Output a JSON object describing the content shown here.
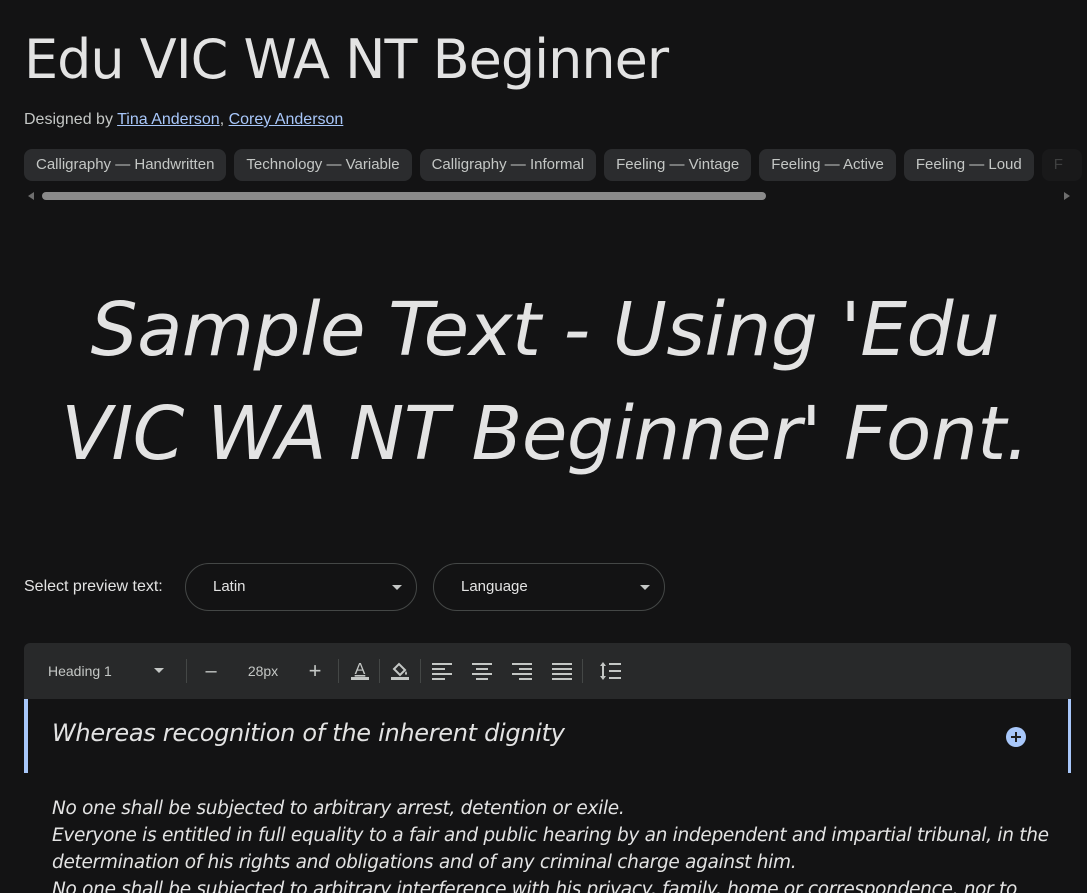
{
  "header": {
    "title": "Edu VIC WA NT Beginner",
    "designed_by_prefix": "Designed by ",
    "designers": [
      "Tina Anderson",
      "Corey Anderson"
    ],
    "designer_separator": ", "
  },
  "tags": [
    "Calligraphy — Handwritten",
    "Technology — Variable",
    "Calligraphy — Informal",
    "Feeling — Vintage",
    "Feeling — Active",
    "Feeling — Loud",
    "F"
  ],
  "sample_text": "Sample Text - Using 'Edu VIC WA NT Beginner' Font.",
  "preview": {
    "label": "Select preview text:",
    "script_select": "Latin",
    "language_select": "Language"
  },
  "toolbar": {
    "style": "Heading 1",
    "decrease": "–",
    "size": "28px",
    "increase": "+",
    "icons": [
      "text-color-icon",
      "fill-color-icon",
      "align-left-icon",
      "align-center-icon",
      "align-right-icon",
      "align-justify-icon",
      "line-spacing-icon"
    ]
  },
  "editor": {
    "heading": "Whereas recognition of the inherent dignity",
    "paragraphs": [
      "No one shall be subjected to arbitrary arrest, detention or exile.",
      "Everyone is entitled in full equality to a fair and public hearing by an independent and impartial tribunal, in the determination of his rights and obligations and of any criminal charge against him.",
      "No one shall be subjected to arbitrary interference with his privacy, family, home or correspondence, nor to"
    ]
  },
  "colors": {
    "background": "#131314",
    "accent": "#a8c7fa",
    "chip": "#2b2c2e",
    "toolbar": "#28292a"
  }
}
